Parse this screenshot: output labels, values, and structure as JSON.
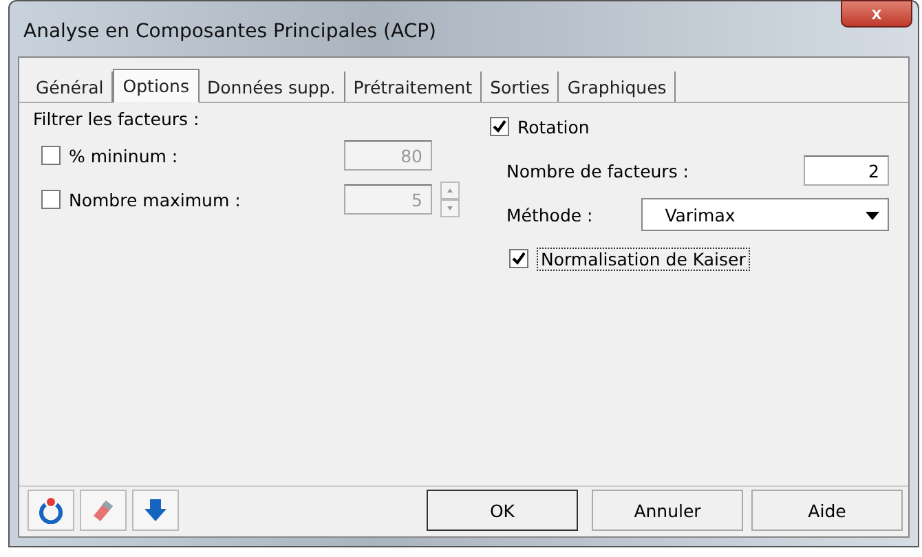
{
  "window": {
    "title": "Analyse en Composantes Principales (ACP)",
    "close": "x"
  },
  "tabs": [
    {
      "label": "Général",
      "selected": false
    },
    {
      "label": "Options",
      "selected": true
    },
    {
      "label": "Données supp.",
      "selected": false
    },
    {
      "label": "Prétraitement",
      "selected": false
    },
    {
      "label": "Sorties",
      "selected": false
    },
    {
      "label": "Graphiques",
      "selected": false
    }
  ],
  "filter": {
    "heading": "Filtrer les facteurs :",
    "rows": [
      {
        "label": "% mininum :",
        "checked": false,
        "value": "80",
        "spinner": false
      },
      {
        "label": "Nombre maximum :",
        "checked": false,
        "value": "5",
        "spinner": true
      }
    ]
  },
  "rotation": {
    "label": "Rotation",
    "checked": true,
    "factors_label": "Nombre de facteurs :",
    "factors_value": "2",
    "method_label": "Méthode :",
    "method_value": "Varimax",
    "kaiser_label": "Normalisation de Kaiser",
    "kaiser_checked": true
  },
  "buttons": [
    "OK",
    "Annuler",
    "Aide"
  ]
}
